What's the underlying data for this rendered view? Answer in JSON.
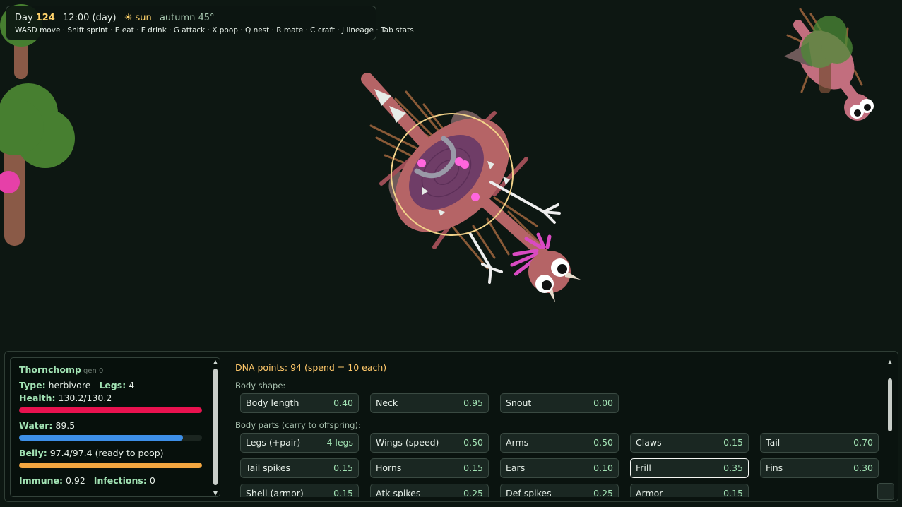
{
  "hud": {
    "day_label": "Day",
    "day_value": "124",
    "time": "12:00 (day)",
    "weather": "☀ sun",
    "season": "autumn 45°",
    "controls": "WASD move · Shift sprint · E eat · F drink · G attack · X poop · Q nest · R mate · C craft · J lineage · Tab stats"
  },
  "stats": {
    "name": "Thornchomp",
    "gen": "gen 0",
    "type_label": "Type:",
    "type_value": "herbivore",
    "legs_label": "Legs:",
    "legs_value": "4",
    "health_label": "Health:",
    "health_value": "130.2/130.2",
    "health_fraction": 1.0,
    "water_label": "Water:",
    "water_value": "89.5",
    "water_fraction": 0.895,
    "belly_label": "Belly:",
    "belly_value": "97.4/97.4 (ready to poop)",
    "belly_fraction": 1.0,
    "immune_label": "Immune:",
    "immune_value": "0.92",
    "infections_label": "Infections:",
    "infections_value": "0"
  },
  "dna": {
    "title": "DNA points: 94 (spend = 10 each)",
    "body_shape_label": "Body shape:",
    "body_shape": [
      {
        "label": "Body length",
        "value": "0.40"
      },
      {
        "label": "Neck",
        "value": "0.95"
      },
      {
        "label": "Snout",
        "value": "0.00"
      }
    ],
    "body_parts_label": "Body parts (carry to offspring):",
    "body_parts": [
      {
        "label": "Legs (+pair)",
        "value": "4 legs"
      },
      {
        "label": "Wings (speed)",
        "value": "0.50"
      },
      {
        "label": "Arms",
        "value": "0.50"
      },
      {
        "label": "Claws",
        "value": "0.15"
      },
      {
        "label": "Tail",
        "value": "0.70"
      },
      {
        "label": "Tail spikes",
        "value": "0.15"
      },
      {
        "label": "Horns",
        "value": "0.15"
      },
      {
        "label": "Ears",
        "value": "0.10"
      },
      {
        "label": "Frill",
        "value": "0.35",
        "selected": true
      },
      {
        "label": "Fins",
        "value": "0.30"
      },
      {
        "label": "Shell (armor)",
        "value": "0.15"
      },
      {
        "label": "Atk spikes",
        "value": "0.25"
      },
      {
        "label": "Def spikes",
        "value": "0.25"
      },
      {
        "label": "Armor",
        "value": "0.15"
      }
    ]
  },
  "colors": {
    "background": "#0d1712",
    "health": "#e8124f",
    "water": "#3d8fe8",
    "belly": "#f3a640",
    "accent_green": "#a2e3b4",
    "dna_title": "#ffc86a"
  }
}
